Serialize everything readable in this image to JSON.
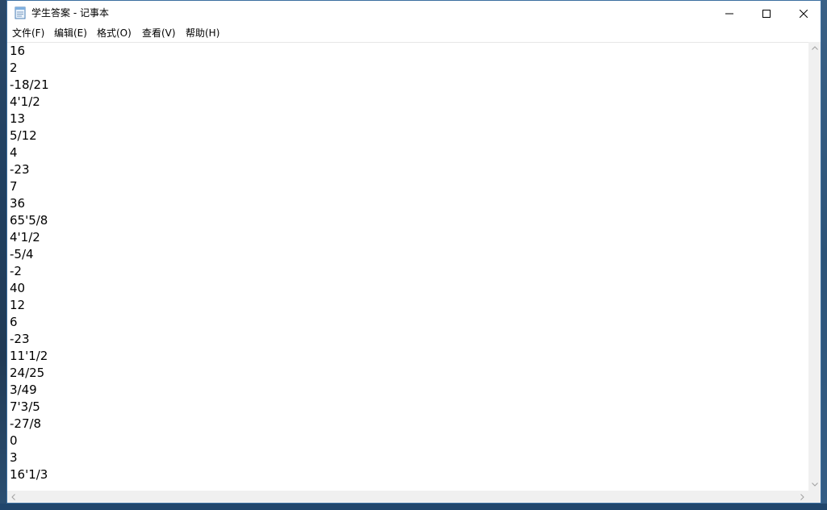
{
  "window": {
    "title": "学生答案 - 记事本"
  },
  "menu": {
    "items": [
      {
        "label": "文件(F)"
      },
      {
        "label": "编辑(E)"
      },
      {
        "label": "格式(O)"
      },
      {
        "label": "查看(V)"
      },
      {
        "label": "帮助(H)"
      }
    ]
  },
  "editor": {
    "lines": [
      "16",
      "2",
      "-18/21",
      "4'1/2",
      "13",
      "5/12",
      "4",
      "-23",
      "7",
      "36",
      "65'5/8",
      "4'1/2",
      "-5/4",
      "-2",
      "40",
      "12",
      "6",
      "-23",
      "11'1/2",
      "24/25",
      "3/49",
      "7'3/5",
      "-27/8",
      "0",
      "3",
      "16'1/3"
    ]
  },
  "icons": {
    "app": "notepad-icon",
    "minimize": "minimize-icon",
    "maximize": "maximize-icon",
    "close": "close-icon"
  },
  "colors": {
    "window_border": "#3c6fa0",
    "scrollbar_bg": "#f0f0f0",
    "text": "#000000"
  }
}
